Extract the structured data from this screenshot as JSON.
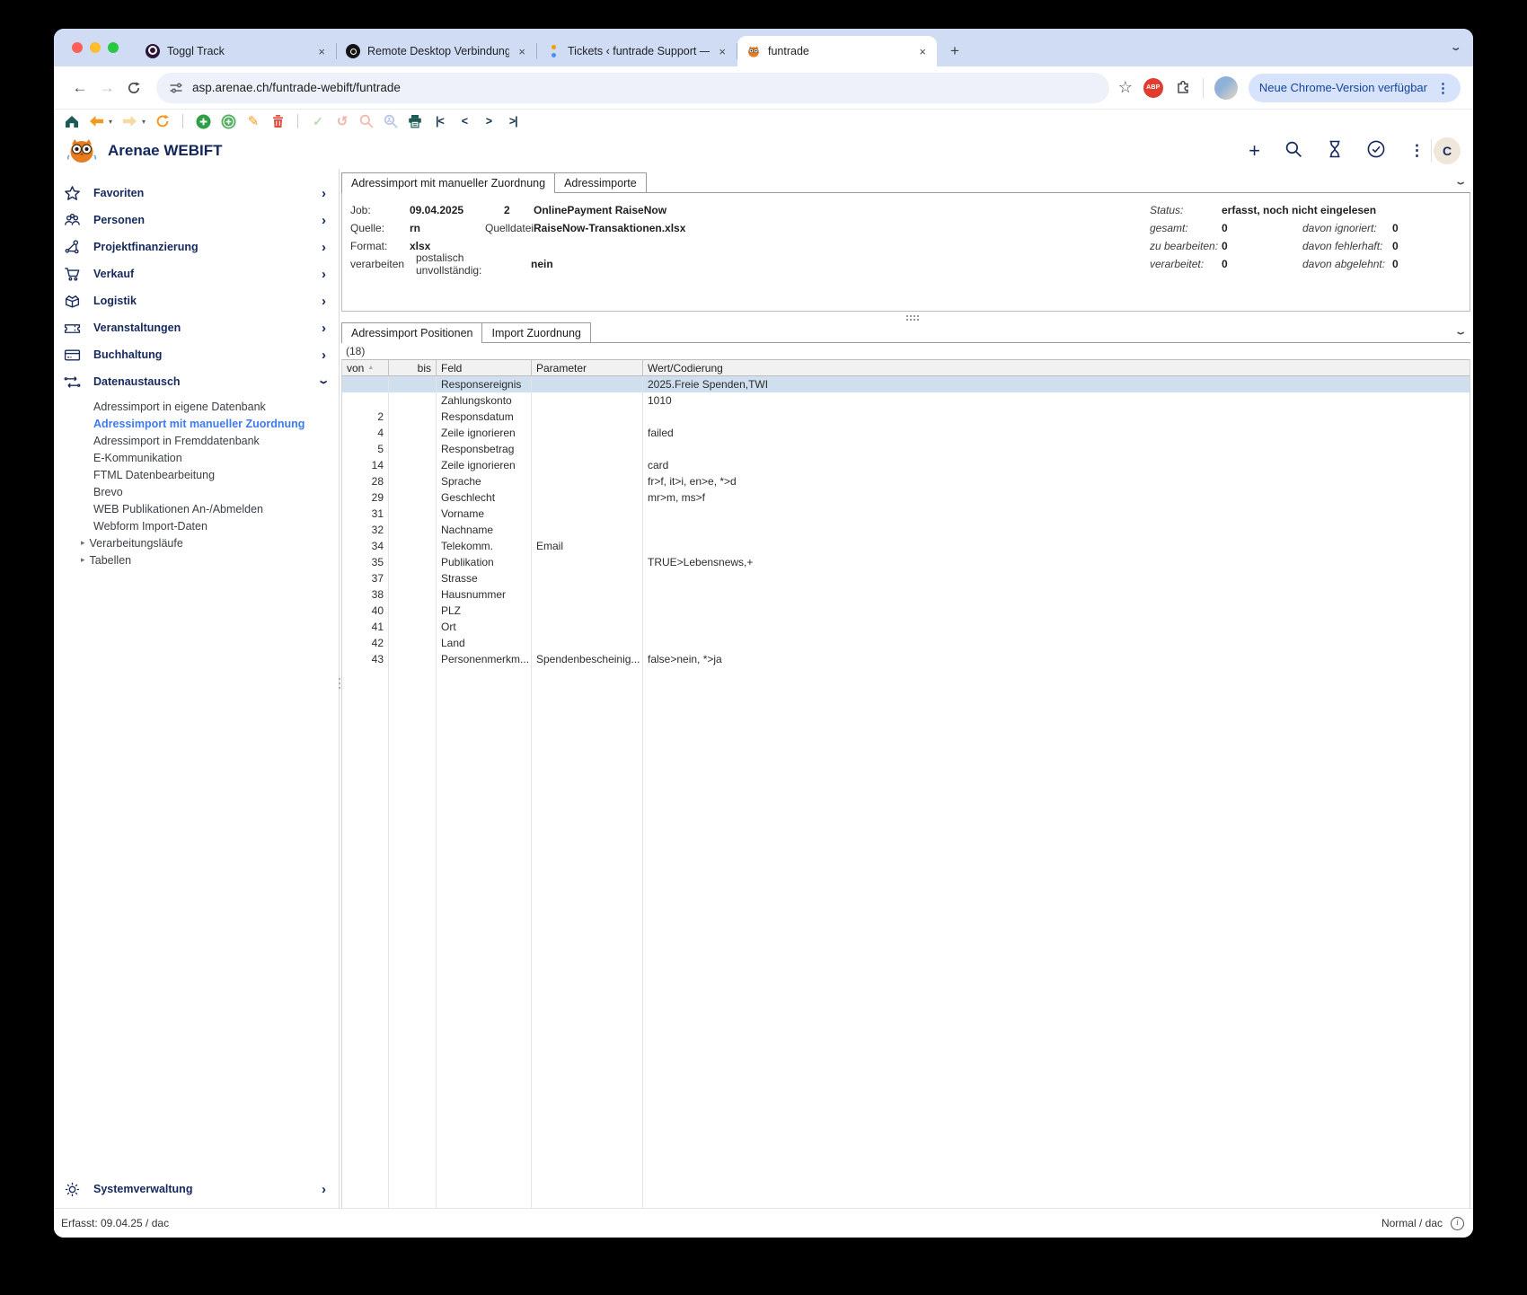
{
  "browser": {
    "tabs": [
      {
        "title": "Toggl Track",
        "favicon": "toggl-icon",
        "active": false
      },
      {
        "title": "Remote Desktop Verbindung",
        "favicon": "rdp-icon",
        "active": false
      },
      {
        "title": "Tickets ‹ funtrade Support —",
        "favicon": "tickets-icon",
        "active": false
      },
      {
        "title": "funtrade",
        "favicon": "owl-icon",
        "active": true
      }
    ],
    "close_glyph": "×",
    "new_tab_glyph": "+",
    "url": "asp.arenae.ch/funtrade-webift/funtrade",
    "abp_label": "ABP",
    "update_button": "Neue Chrome-Version verfügbar"
  },
  "app": {
    "title": "Arenae WEBIFT",
    "avatar_initial": "C",
    "toolbar_icons": [
      "home",
      "back",
      "back-menu",
      "forward",
      "forward-menu",
      "refresh",
      "divider",
      "add",
      "add-copy",
      "edit",
      "delete",
      "divider",
      "confirm",
      "undo",
      "search",
      "search-person",
      "print",
      "nav-first",
      "nav-prev",
      "nav-next",
      "nav-last"
    ],
    "header_icons": [
      "add",
      "search",
      "hourglass",
      "check-circle",
      "menu"
    ],
    "sidebar": {
      "items": [
        {
          "label": "Favoriten",
          "icon": "star"
        },
        {
          "label": "Personen",
          "icon": "users"
        },
        {
          "label": "Projektfinanzierung",
          "icon": "network"
        },
        {
          "label": "Verkauf",
          "icon": "cart"
        },
        {
          "label": "Logistik",
          "icon": "box"
        },
        {
          "label": "Veranstaltungen",
          "icon": "ticket"
        },
        {
          "label": "Buchhaltung",
          "icon": "card"
        },
        {
          "label": "Datenaustausch",
          "icon": "exchange",
          "expanded": true
        }
      ],
      "children": [
        {
          "label": "Adressimport in eigene Datenbank"
        },
        {
          "label": "Adressimport mit manueller Zuordnung",
          "selected": true
        },
        {
          "label": "Adressimport in Fremddatenbank"
        },
        {
          "label": "E-Kommunikation"
        },
        {
          "label": "FTML Datenbearbeitung"
        },
        {
          "label": "Brevo"
        },
        {
          "label": "WEB Publikationen An-/Abmelden"
        },
        {
          "label": "Webform Import-Daten"
        },
        {
          "label": "Verarbeitungsläufe",
          "expandable": true
        },
        {
          "label": "Tabellen",
          "expandable": true
        }
      ],
      "bottom_item": {
        "label": "Systemverwaltung",
        "icon": "gear"
      }
    },
    "job_panel": {
      "tabs": [
        {
          "label": "Adressimport mit manueller Zuordnung",
          "active": true
        },
        {
          "label": "Adressimporte",
          "active": false
        }
      ],
      "fields": {
        "job_label": "Job:",
        "job_date": "09.04.2025",
        "job_number": "2",
        "job_name": "OnlinePayment RaiseNow",
        "quelle_label": "Quelle:",
        "quelle": "rn",
        "quelldatei_label": "Quelldatei:",
        "quelldatei": "RaiseNow-Transaktionen.xlsx",
        "format_label": "Format:",
        "format": "xlsx",
        "verarbeiten_label": "verarbeiten",
        "postalisch_label": "postalisch unvollständig:",
        "postalisch_value": "nein"
      },
      "status": {
        "status_label": "Status:",
        "status_value": "erfasst, noch nicht eingelesen",
        "rows": [
          {
            "l1": "gesamt:",
            "v1": "0",
            "l2": "davon ignoriert:",
            "v2": "0"
          },
          {
            "l1": "zu bearbeiten:",
            "v1": "0",
            "l2": "davon fehlerhaft:",
            "v2": "0"
          },
          {
            "l1": "verarbeitet:",
            "v1": "0",
            "l2": "davon abgelehnt:",
            "v2": "0"
          }
        ]
      }
    },
    "positions_panel": {
      "tabs": [
        {
          "label": "Adressimport Positionen",
          "active": true
        },
        {
          "label": "Import Zuordnung",
          "active": false
        }
      ],
      "count": "(18)",
      "columns": [
        "von",
        "bis",
        "Feld",
        "Parameter",
        "Wert/Codierung"
      ],
      "rows": [
        {
          "von": "",
          "bis": "",
          "feld": "Responsereignis",
          "parameter": "",
          "wert": "2025.Freie Spenden,TWI",
          "selected": true
        },
        {
          "von": "",
          "bis": "",
          "feld": "Zahlungskonto",
          "parameter": "",
          "wert": "1010"
        },
        {
          "von": "2",
          "bis": "",
          "feld": "Responsdatum",
          "parameter": "",
          "wert": ""
        },
        {
          "von": "4",
          "bis": "",
          "feld": "Zeile ignorieren",
          "parameter": "",
          "wert": "failed"
        },
        {
          "von": "5",
          "bis": "",
          "feld": "Responsbetrag",
          "parameter": "",
          "wert": ""
        },
        {
          "von": "14",
          "bis": "",
          "feld": "Zeile ignorieren",
          "parameter": "",
          "wert": "card"
        },
        {
          "von": "28",
          "bis": "",
          "feld": "Sprache",
          "parameter": "",
          "wert": "fr>f, it>i, en>e, *>d"
        },
        {
          "von": "29",
          "bis": "",
          "feld": "Geschlecht",
          "parameter": "",
          "wert": "mr>m, ms>f"
        },
        {
          "von": "31",
          "bis": "",
          "feld": "Vorname",
          "parameter": "",
          "wert": ""
        },
        {
          "von": "32",
          "bis": "",
          "feld": "Nachname",
          "parameter": "",
          "wert": ""
        },
        {
          "von": "34",
          "bis": "",
          "feld": "Telekomm.",
          "parameter": "Email",
          "wert": ""
        },
        {
          "von": "35",
          "bis": "",
          "feld": "Publikation",
          "parameter": "",
          "wert": "TRUE>Lebensnews,+"
        },
        {
          "von": "37",
          "bis": "",
          "feld": "Strasse",
          "parameter": "",
          "wert": ""
        },
        {
          "von": "38",
          "bis": "",
          "feld": "Hausnummer",
          "parameter": "",
          "wert": ""
        },
        {
          "von": "40",
          "bis": "",
          "feld": "PLZ",
          "parameter": "",
          "wert": ""
        },
        {
          "von": "41",
          "bis": "",
          "feld": "Ort",
          "parameter": "",
          "wert": ""
        },
        {
          "von": "42",
          "bis": "",
          "feld": "Land",
          "parameter": "",
          "wert": ""
        },
        {
          "von": "43",
          "bis": "",
          "feld": "Personenmerkm...",
          "parameter": "Spendenbescheinig...",
          "wert": "false>nein, *>ja"
        }
      ]
    },
    "statusbar": {
      "left": "Erfasst: 09.04.25 / dac",
      "right": "Normal / dac"
    }
  }
}
